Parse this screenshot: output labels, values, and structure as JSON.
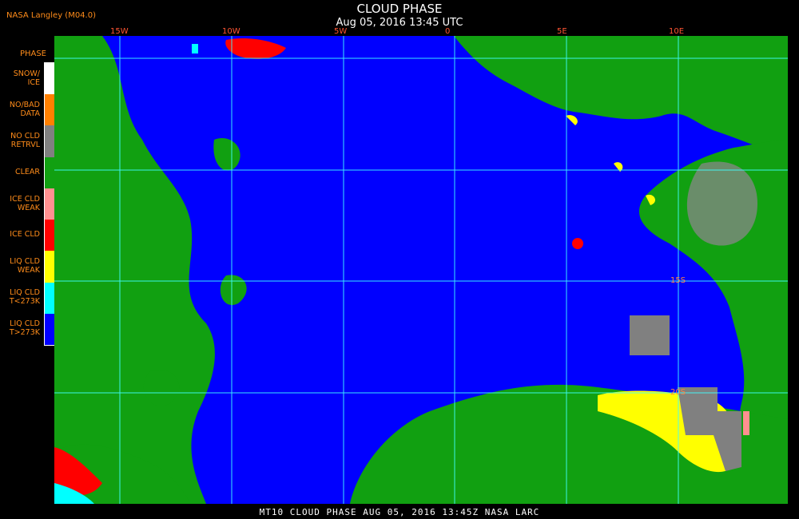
{
  "header": {
    "title": "CLOUD PHASE",
    "datetime": "Aug 05, 2016 13:45 UTC",
    "credit": "NASA Langley (M04.0)"
  },
  "legend": {
    "title": "PHASE",
    "items": [
      {
        "label": "SNOW/\nICE",
        "color": "#ffffff"
      },
      {
        "label": "NO/BAD\nDATA",
        "color": "#ff8000"
      },
      {
        "label": "NO CLD\nRETRVL",
        "color": "#808080"
      },
      {
        "label": "CLEAR",
        "color": "#11a011"
      },
      {
        "label": "ICE CLD\nWEAK",
        "color": "#ff9090"
      },
      {
        "label": "ICE CLD",
        "color": "#ff0000"
      },
      {
        "label": "LIQ CLD\nWEAK",
        "color": "#ffff00"
      },
      {
        "label": "LIQ CLD\nT<273K",
        "color": "#00ffff"
      },
      {
        "label": "LIQ CLD\nT>273K",
        "color": "#0000ff"
      }
    ]
  },
  "grid": {
    "longitude_labels": [
      "15W",
      "10W",
      "5W",
      "0",
      "5E",
      "10E"
    ],
    "latitude_labels": [
      "15S",
      "20S"
    ],
    "grid_color": "#40ffff"
  },
  "footer": "MT10  CLOUD PHASE  AUG 05, 2016 13:45Z  NASA LARC"
}
